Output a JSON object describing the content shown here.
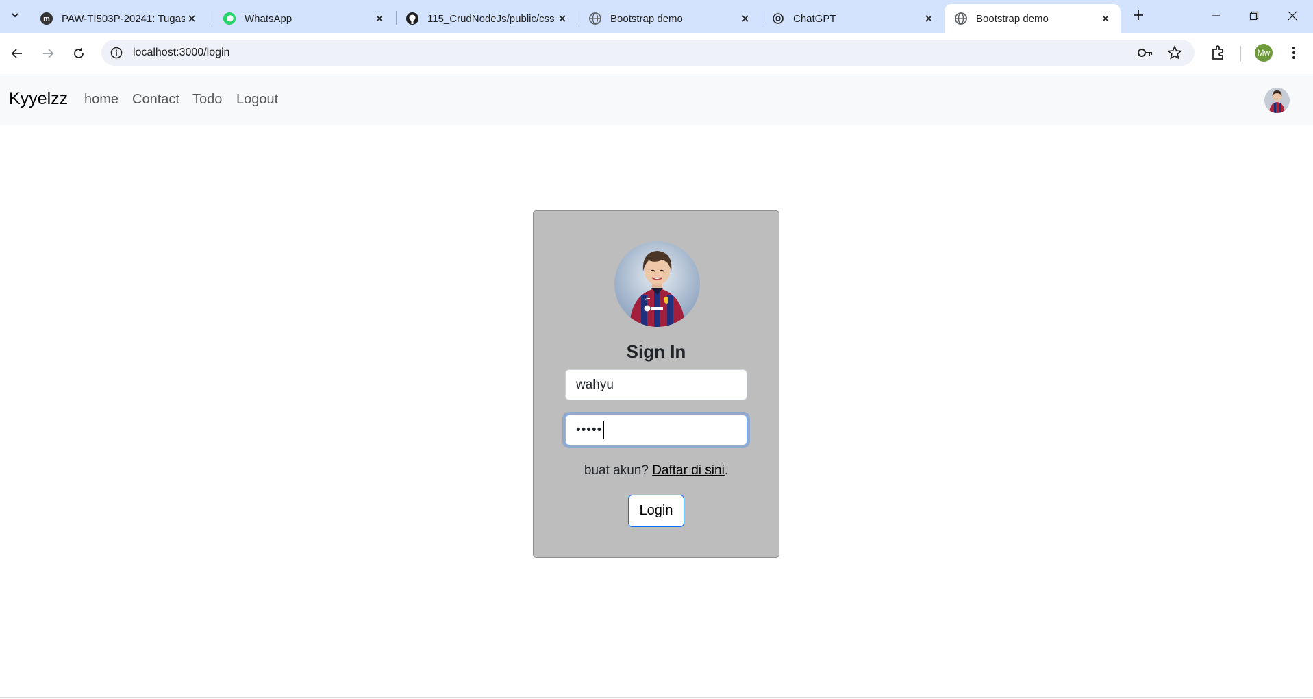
{
  "browser": {
    "tabs": [
      {
        "title": "PAW-TI503P-20241: Tugas",
        "favicon": "moodle-icon"
      },
      {
        "title": "WhatsApp",
        "favicon": "whatsapp-icon"
      },
      {
        "title": "115_CrudNodeJs/public/css",
        "favicon": "github-icon"
      },
      {
        "title": "Bootstrap demo",
        "favicon": "globe-icon"
      },
      {
        "title": "ChatGPT",
        "favicon": "chatgpt-icon"
      },
      {
        "title": "Bootstrap demo",
        "favicon": "globe-icon",
        "active": true
      }
    ],
    "url": "localhost:3000/login",
    "profile_initials": "Mw"
  },
  "navbar": {
    "brand": "Kyyelzz",
    "links": [
      "home",
      "Contact",
      "Todo",
      "Logout"
    ]
  },
  "login": {
    "title": "Sign In",
    "username_value": "wahyu",
    "password_masked": "•••••",
    "signup_prompt": "buat akun?",
    "signup_link": "Daftar di sini",
    "signup_suffix": ".",
    "button_label": "Login"
  },
  "colors": {
    "tabstrip": "#d3e3fd",
    "card_bg": "#bdbdbd",
    "focus_ring": "#86b7fe",
    "button_border": "#0d6efd"
  }
}
